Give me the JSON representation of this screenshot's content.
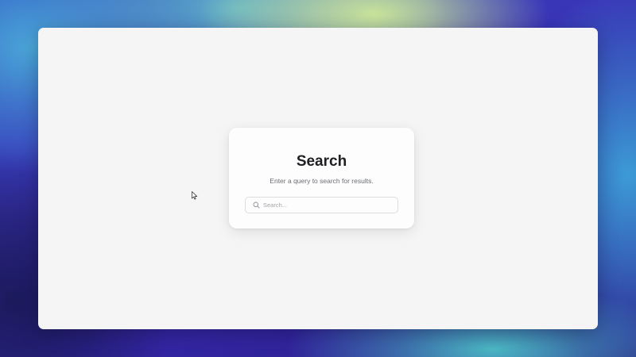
{
  "search_panel": {
    "title": "Search",
    "subtitle": "Enter a query to search for results.",
    "input_placeholder": "Search...",
    "input_value": ""
  },
  "icons": {
    "search": "search-icon",
    "cursor": "mouse-pointer-icon"
  },
  "colors": {
    "window_background": "#f4f5f4",
    "card_background": "#fdfdfd",
    "title_text": "#1f1f23",
    "subtitle_text": "#6b6d73",
    "placeholder_text": "#a3a5aa",
    "input_border": "#dcdde0"
  }
}
